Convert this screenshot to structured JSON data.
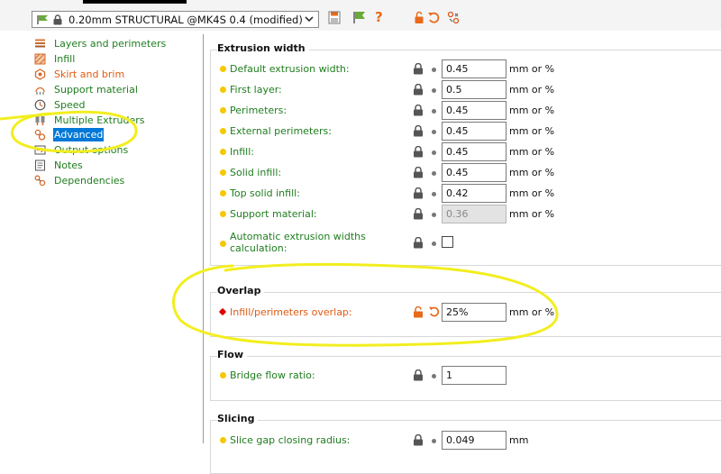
{
  "toolbar": {
    "preset_name": "0.20mm STRUCTURAL @MK4S 0.4 (modified)",
    "icons": [
      "flag-icon",
      "lock-icon",
      "dropdown-icon",
      "save-icon",
      "flag-icon",
      "help-icon",
      "unlock-icon",
      "undo-icon",
      "settings-icon"
    ],
    "help_glyph": "?"
  },
  "sidebar": {
    "items": [
      {
        "label": "Layers and perimeters",
        "color": "green",
        "icon": "layers-icon"
      },
      {
        "label": "Infill",
        "color": "green",
        "icon": "infill-icon"
      },
      {
        "label": "Skirt and brim",
        "color": "orange",
        "icon": "skirt-icon"
      },
      {
        "label": "Support material",
        "color": "green",
        "icon": "support-icon"
      },
      {
        "label": "Speed",
        "color": "green",
        "icon": "speed-icon"
      },
      {
        "label": "Multiple Extruders",
        "color": "green",
        "icon": "extruders-icon"
      },
      {
        "label": "Advanced",
        "color": "selected",
        "icon": "advanced-icon"
      },
      {
        "label": "Output options",
        "color": "green",
        "icon": "output-icon"
      },
      {
        "label": "Notes",
        "color": "green",
        "icon": "notes-icon"
      },
      {
        "label": "Dependencies",
        "color": "green",
        "icon": "dependencies-icon"
      }
    ]
  },
  "groups": {
    "extrusion_width": {
      "title": "Extrusion width",
      "rows": [
        {
          "label": "Default extrusion width:",
          "value": "0.45",
          "unit": "mm or %"
        },
        {
          "label": "First layer:",
          "value": "0.5",
          "unit": "mm or %"
        },
        {
          "label": "Perimeters:",
          "value": "0.45",
          "unit": "mm or %"
        },
        {
          "label": "External perimeters:",
          "value": "0.45",
          "unit": "mm or %"
        },
        {
          "label": "Infill:",
          "value": "0.45",
          "unit": "mm or %"
        },
        {
          "label": "Solid infill:",
          "value": "0.45",
          "unit": "mm or %"
        },
        {
          "label": "Top solid infill:",
          "value": "0.42",
          "unit": "mm or %"
        },
        {
          "label": "Support material:",
          "value": "0.36",
          "unit": "mm or %",
          "disabled": true
        }
      ],
      "auto_label_1": "Automatic extrusion widths",
      "auto_label_2": "calculation:",
      "auto_checked": false
    },
    "overlap": {
      "title": "Overlap",
      "row": {
        "label": "Infill/perimeters overlap:",
        "value": "25%",
        "unit": "mm or %",
        "modified": true
      }
    },
    "flow": {
      "title": "Flow",
      "row": {
        "label": "Bridge flow ratio:",
        "value": "1",
        "unit": ""
      }
    },
    "slicing": {
      "title": "Slicing",
      "row": {
        "label": "Slice gap closing radius:",
        "value": "0.049",
        "unit": "mm"
      }
    }
  },
  "colors": {
    "green": "#1f7d1f",
    "orange": "#e05a12",
    "selected": "#0078d7",
    "annotation": "#f2ee1f"
  }
}
